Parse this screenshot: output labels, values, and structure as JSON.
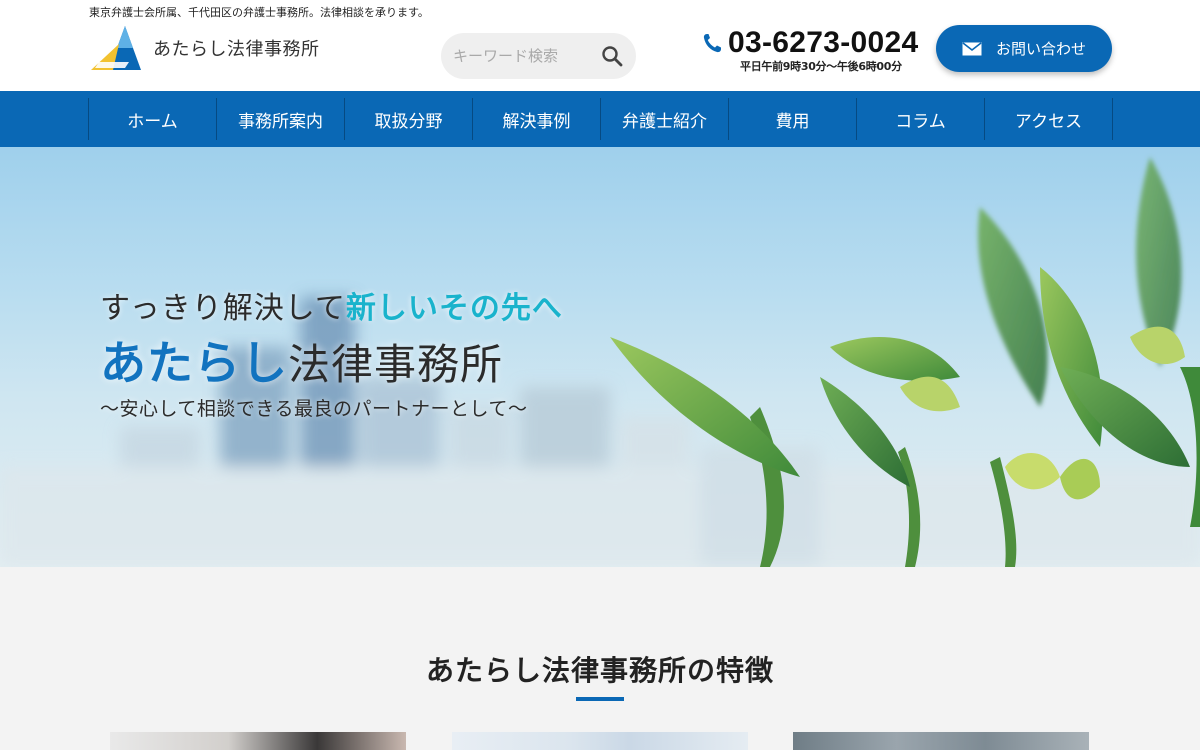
{
  "header": {
    "tagline": "東京弁護士会所属、千代田区の弁護士事務所。法律相談を承ります。",
    "logo_text": "あたらし法律事務所",
    "search": {
      "placeholder": "キーワード検索",
      "value": ""
    },
    "tel": {
      "number": "03-6273-0024",
      "hours": "平日午前9時30分〜午後6時00分"
    },
    "contact_label": "お問い合わせ"
  },
  "nav": {
    "items": [
      {
        "label": "ホーム"
      },
      {
        "label": "事務所案内"
      },
      {
        "label": "取扱分野"
      },
      {
        "label": "解決事例"
      },
      {
        "label": "弁護士紹介"
      },
      {
        "label": "費用"
      },
      {
        "label": "コラム"
      },
      {
        "label": "アクセス"
      }
    ]
  },
  "hero": {
    "copy_plain": "すっきり解決して",
    "copy_accent": "新しいその先へ",
    "title_kana": "あたらし",
    "title_kanji": "法律事務所",
    "subtitle": "〜安心して相談できる最良のパートナーとして〜"
  },
  "features": {
    "heading": "あたらし法律事務所の特徴"
  },
  "colors": {
    "brand_blue": "#0a68b5",
    "accent_cyan": "#19b3cc",
    "title_blue": "#1273bf"
  }
}
